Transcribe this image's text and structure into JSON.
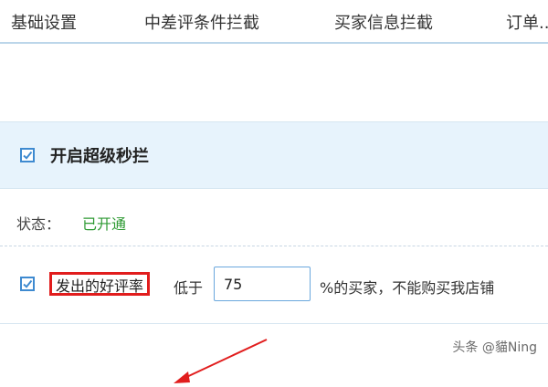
{
  "tabs": [
    {
      "label": "基础设置"
    },
    {
      "label": "中差评条件拦截"
    },
    {
      "label": "买家信息拦截"
    },
    {
      "label": "订单..."
    }
  ],
  "panel": {
    "header_title": "开启超级秒拦",
    "status_label": "状态：",
    "status_value": "已开通",
    "rate_label": "发出的好评率",
    "rate_suffix": "低于",
    "rate_value": "75",
    "rate_tail": "%的买家，不能购买我店铺"
  },
  "watermark": "头条 @貓Ning",
  "colors": {
    "accent": "#3e8ad0",
    "status_green": "#2e9a33",
    "highlight_red": "#e11d1d",
    "header_bg": "#e7f3fc"
  }
}
